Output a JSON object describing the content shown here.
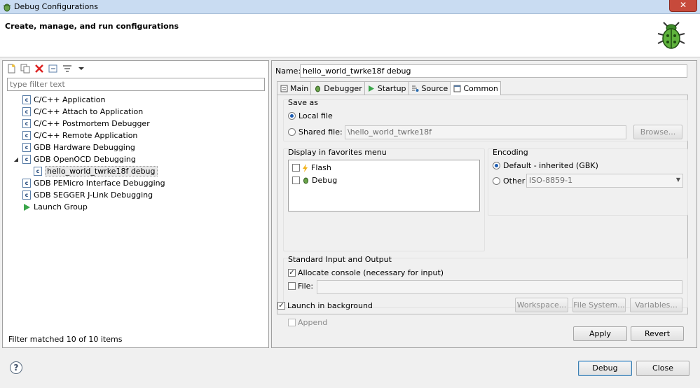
{
  "window": {
    "title": "Debug Configurations",
    "close_label": "✕"
  },
  "banner": {
    "heading": "Create, manage, and run configurations"
  },
  "left": {
    "filter_placeholder": "type filter text",
    "tree": [
      {
        "label": "C/C++ Application",
        "level": 0,
        "expanded": null
      },
      {
        "label": "C/C++ Attach to Application",
        "level": 0,
        "expanded": null
      },
      {
        "label": "C/C++ Postmortem Debugger",
        "level": 0,
        "expanded": null
      },
      {
        "label": "C/C++ Remote Application",
        "level": 0,
        "expanded": null
      },
      {
        "label": "GDB Hardware Debugging",
        "level": 0,
        "expanded": null
      },
      {
        "label": "GDB OpenOCD Debugging",
        "level": 0,
        "expanded": true
      },
      {
        "label": "hello_world_twrke18f debug",
        "level": 1,
        "expanded": null
      },
      {
        "label": "GDB PEMicro Interface Debugging",
        "level": 0,
        "expanded": null
      },
      {
        "label": "GDB SEGGER J-Link Debugging",
        "level": 0,
        "expanded": null
      },
      {
        "label": "Launch Group",
        "level": 0,
        "expanded": null
      }
    ],
    "status": "Filter matched 10 of 10 items"
  },
  "right": {
    "name_label": "Name:",
    "name_value": "hello_world_twrke18f debug",
    "tabs": [
      "Main",
      "Debugger",
      "Startup",
      "Source",
      "Common"
    ],
    "save_as": {
      "title": "Save as",
      "local_file": "Local file",
      "shared_file": "Shared file:",
      "shared_value": "\\hello_world_twrke18f",
      "browse": "Browse..."
    },
    "favorites": {
      "title": "Display in favorites menu",
      "items": [
        "Flash",
        "Debug"
      ]
    },
    "encoding": {
      "title": "Encoding",
      "default": "Default - inherited (GBK)",
      "other": "Other",
      "other_value": "ISO-8859-1"
    },
    "stdio": {
      "title": "Standard Input and Output",
      "allocate": "Allocate console (necessary for input)",
      "file": "File:",
      "workspace": "Workspace...",
      "file_system": "File System...",
      "variables": "Variables...",
      "append": "Append"
    },
    "launch_bg": "Launch in background",
    "apply": "Apply",
    "revert": "Revert"
  },
  "footer": {
    "help": "?",
    "debug": "Debug",
    "close": "Close"
  }
}
